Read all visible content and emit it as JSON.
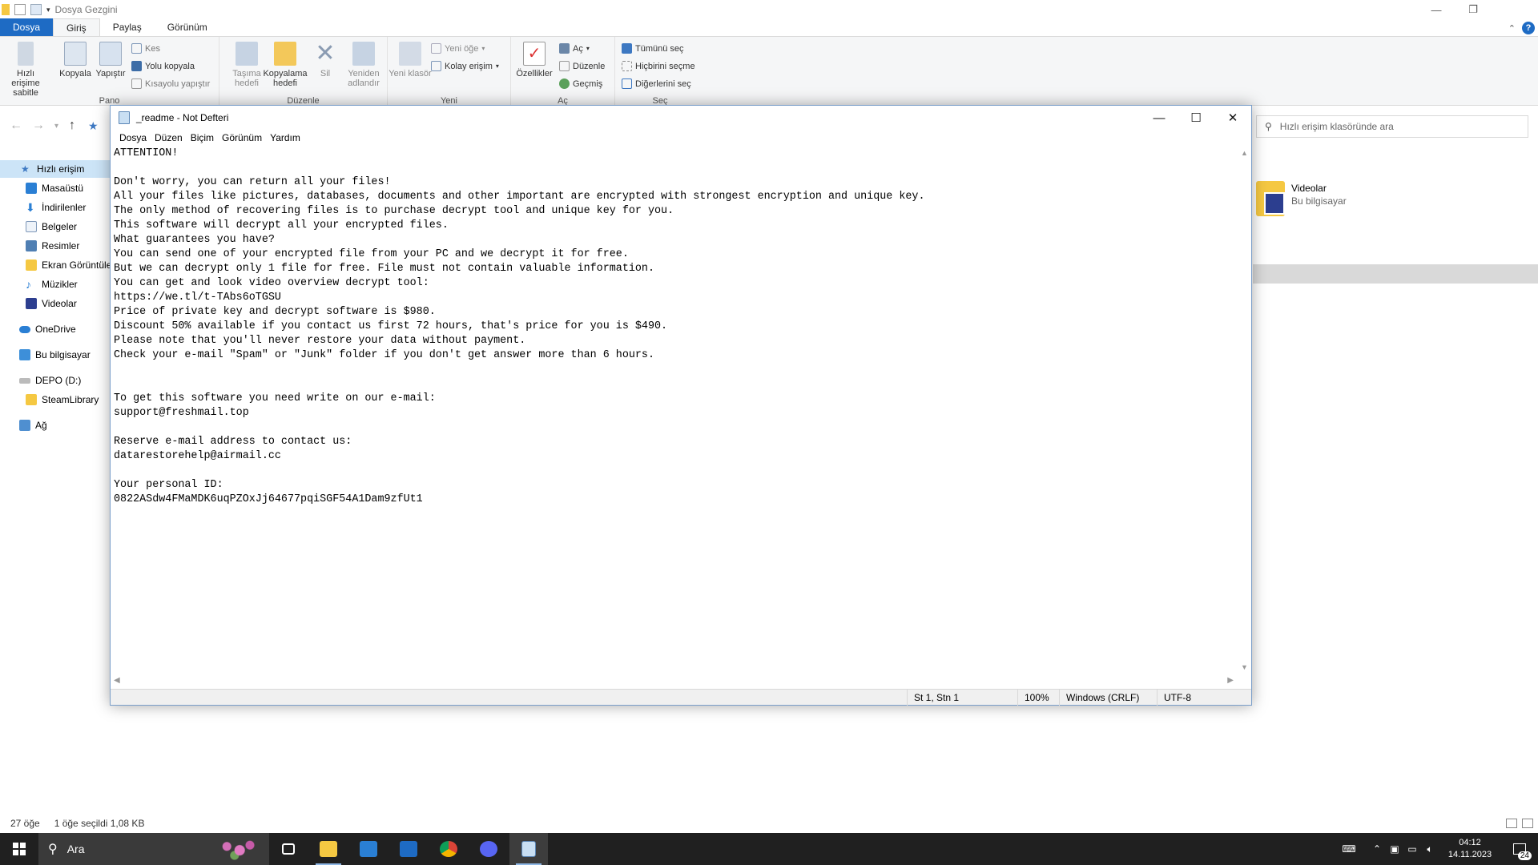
{
  "explorer": {
    "title": "Dosya Gezgini",
    "tabs": [
      "Dosya",
      "Giriş",
      "Paylaş",
      "Görünüm"
    ],
    "ribbon": {
      "pano": {
        "pin": "Hızlı erişime sabitle",
        "copy": "Kopyala",
        "paste": "Yapıştır",
        "cut": "Kes",
        "copy_path": "Yolu kopyala",
        "paste_shortcut": "Kısayolu yapıştır",
        "label": "Pano"
      },
      "duzenle": {
        "move_to": "Taşıma hedefi",
        "copy_to": "Kopyalama hedefi",
        "delete": "Sil",
        "rename": "Yeniden adlandır",
        "label": "Düzenle"
      },
      "yeni": {
        "new_folder": "Yeni klasör",
        "new_item": "Yeni öğe",
        "easy_access": "Kolay erişim",
        "label": "Yeni"
      },
      "ac": {
        "properties": "Özellikler",
        "open": "Aç",
        "edit": "Düzenle",
        "history": "Geçmiş",
        "label": "Aç"
      },
      "sec": {
        "select_all": "Tümünü seç",
        "select_none": "Hiçbirini seçme",
        "invert": "Diğerlerini seç",
        "label": "Seç"
      }
    },
    "search_placeholder": "Hızlı erişim klasöründe ara",
    "nav": [
      {
        "label": "Hızlı erişim",
        "icon": "star-icon"
      },
      {
        "label": "Masaüstü",
        "icon": "desktop-icon"
      },
      {
        "label": "İndirilenler",
        "icon": "download-icon"
      },
      {
        "label": "Belgeler",
        "icon": "documents-icon"
      },
      {
        "label": "Resimler",
        "icon": "pictures-icon"
      },
      {
        "label": "Ekran Görüntüleri",
        "icon": "folder-icon"
      },
      {
        "label": "Müzikler",
        "icon": "music-icon"
      },
      {
        "label": "Videolar",
        "icon": "videos-icon"
      },
      {
        "label": "OneDrive",
        "icon": "cloud-icon"
      },
      {
        "label": "Bu bilgisayar",
        "icon": "computer-icon"
      },
      {
        "label": "DEPO (D:)",
        "icon": "drive-icon"
      },
      {
        "label": "SteamLibrary",
        "icon": "folder-icon"
      },
      {
        "label": "Ağ",
        "icon": "network-icon"
      }
    ],
    "content_item": {
      "name": "Videolar",
      "location": "Bu bilgisayar"
    },
    "status": {
      "count": "27 öğe",
      "selected": "1 öğe seçildi  1,08 KB"
    }
  },
  "notepad": {
    "title": "_readme - Not Defteri",
    "menu": [
      "Dosya",
      "Düzen",
      "Biçim",
      "Görünüm",
      "Yardım"
    ],
    "text": "ATTENTION!\n\nDon't worry, you can return all your files!\nAll your files like pictures, databases, documents and other important are encrypted with strongest encryption and unique key.\nThe only method of recovering files is to purchase decrypt tool and unique key for you.\nThis software will decrypt all your encrypted files.\nWhat guarantees you have?\nYou can send one of your encrypted file from your PC and we decrypt it for free.\nBut we can decrypt only 1 file for free. File must not contain valuable information.\nYou can get and look video overview decrypt tool:\nhttps://we.tl/t-TAbs6oTGSU\nPrice of private key and decrypt software is $980.\nDiscount 50% available if you contact us first 72 hours, that's price for you is $490.\nPlease note that you'll never restore your data without payment.\nCheck your e-mail \"Spam\" or \"Junk\" folder if you don't get answer more than 6 hours.\n\n\nTo get this software you need write on our e-mail:\nsupport@freshmail.top\n\nReserve e-mail address to contact us:\ndatarestorehelp@airmail.cc\n\nYour personal ID:\n0822ASdw4FMaMDK6uqPZOxJj64677pqiSGF54A1Dam9zfUt1",
    "status": {
      "position": "St 1, Stn 1",
      "zoom": "100%",
      "line_ending": "Windows (CRLF)",
      "encoding": "UTF-8"
    }
  },
  "taskbar": {
    "search_placeholder": "Ara",
    "apps": [
      "task-view-icon",
      "file-explorer-icon",
      "store-icon",
      "mail-icon",
      "chrome-icon",
      "discord-icon",
      "notepad-icon"
    ],
    "clock_time": "04:12",
    "clock_date": "14.11.2023",
    "notification_count": "24"
  }
}
